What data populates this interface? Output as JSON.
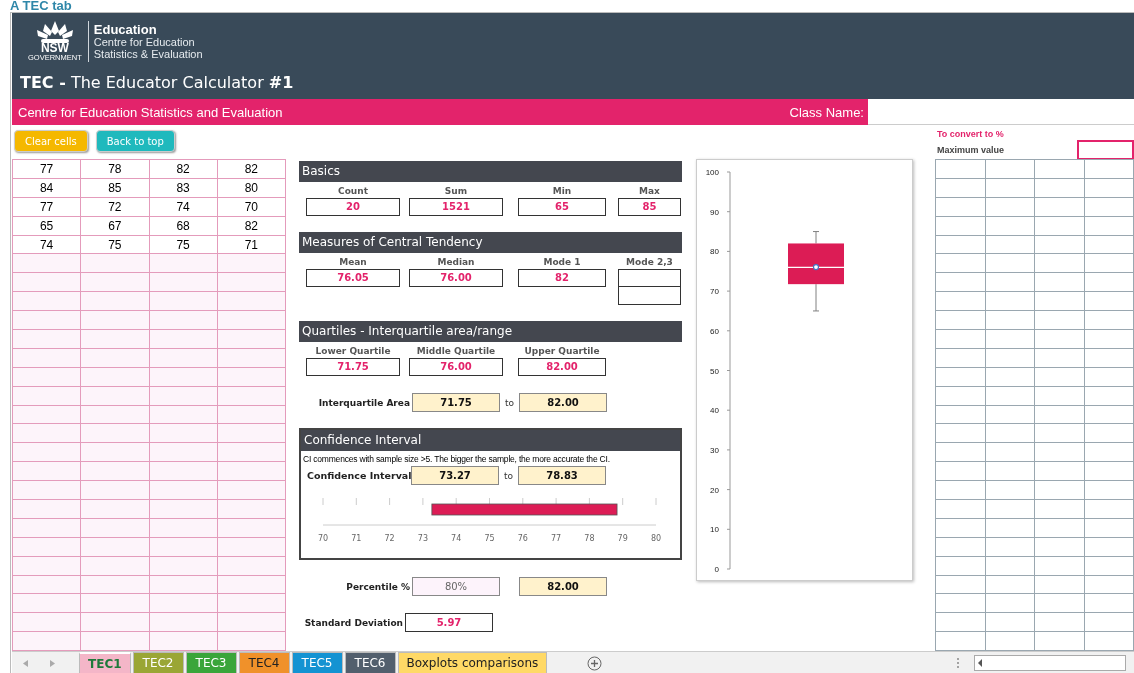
{
  "doc_heading": "A TEC tab",
  "header": {
    "logo": {
      "wordmark": "NSW",
      "sub": "GOVERNMENT",
      "org": "Education",
      "unit_lines": [
        "Centre for Education",
        "Statistics & Evaluation"
      ]
    },
    "title": "**TEC -** The Educator Calculator **#1**"
  },
  "banner": {
    "text": "Centre for Education Statistics and Evaluation",
    "class_label": "Class Name:"
  },
  "buttons": [
    {
      "label": "Clear cells",
      "color": "#f5b800"
    },
    {
      "label": "Back to top",
      "color": "#1fb9bd"
    }
  ],
  "convert": {
    "title": "To convert to %",
    "label": "Maximum value"
  },
  "data_grid": {
    "rows": [
      [
        "77",
        "78",
        "82",
        "82"
      ],
      [
        "84",
        "85",
        "83",
        "80"
      ],
      [
        "77",
        "72",
        "74",
        "70"
      ],
      [
        "65",
        "67",
        "68",
        "82"
      ],
      [
        "74",
        "75",
        "75",
        "71"
      ]
    ]
  },
  "basics": {
    "title": "Basics",
    "fields": [
      {
        "kind": "single",
        "label": "Count",
        "value": "20"
      },
      {
        "kind": "single",
        "label": "Sum",
        "value": "1521"
      },
      {
        "kind": "single",
        "label": "Min",
        "value": "65"
      },
      {
        "kind": "single",
        "label": "Max",
        "value": "85"
      }
    ]
  },
  "central": {
    "title": "Measures of Central Tendency",
    "fields": [
      {
        "kind": "single",
        "label": "Mean",
        "value": "76.05"
      },
      {
        "kind": "single",
        "label": "Median",
        "value": "76.00"
      },
      {
        "kind": "single",
        "label": "Mode 1",
        "value": "82"
      },
      {
        "kind": "double",
        "label": "Mode 2,3"
      }
    ]
  },
  "quartiles": {
    "title": "Quartiles - Interquartile area/range",
    "fields": [
      {
        "kind": "single",
        "label": "Lower Quartile",
        "value": "71.75"
      },
      {
        "kind": "single",
        "label": "Middle Quartile",
        "value": "76.00"
      },
      {
        "kind": "single",
        "label": "Upper Quartile",
        "value": "82.00"
      }
    ],
    "area": {
      "label": "Interquartile Area",
      "from": "71.75",
      "joiner": "to",
      "to": "82.00"
    }
  },
  "confidence": {
    "title": "Confidence Interval",
    "note": "CI commences with sample size >5. The bigger the sample, the more accurate the CI.",
    "label": "Confidence Interval",
    "from": "73.27",
    "joiner": "to",
    "to": "78.83",
    "axis_labels": [
      "70",
      "71",
      "72",
      "73",
      "74",
      "75",
      "76",
      "77",
      "78",
      "79",
      "80"
    ]
  },
  "percentile": {
    "label": "Percentile %",
    "input": "80%",
    "result": "82.00"
  },
  "std_dev": {
    "label": "Standard Deviation",
    "value": "5.97"
  },
  "boxplot": {
    "axis_labels": [
      "100",
      "90",
      "80",
      "70",
      "60",
      "50",
      "40",
      "30",
      "20",
      "10",
      "0"
    ]
  },
  "sheet_tabs": [
    {
      "label": "TEC1",
      "selected": true,
      "color": "#f4b6c8"
    },
    {
      "label": "TEC2",
      "selected": false,
      "color": "#9aa635"
    },
    {
      "label": "TEC3",
      "selected": false,
      "color": "#3aa53a"
    },
    {
      "label": "TEC4",
      "selected": false,
      "color": "#f0912a"
    },
    {
      "label": "TEC5",
      "selected": false,
      "color": "#1493d2"
    },
    {
      "label": "TEC6",
      "selected": false,
      "color": "#525f6d"
    },
    {
      "label": "Boxplots comparisons",
      "selected": false,
      "color": "#ffd966"
    }
  ]
}
